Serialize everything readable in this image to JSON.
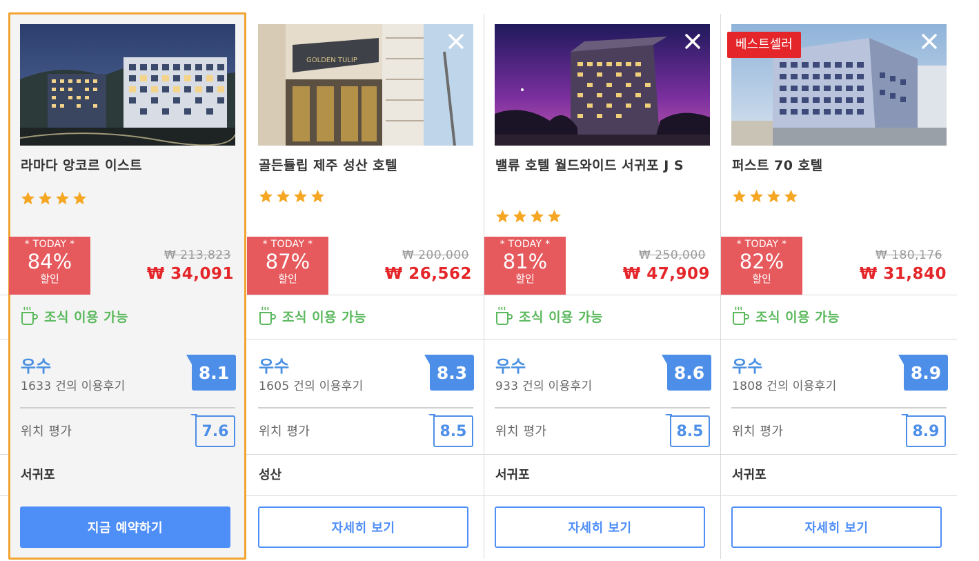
{
  "hotels": [
    {
      "name": "라마다 앙코르 이스트",
      "stars": 4,
      "discount_today": "* TODAY *",
      "discount_pct": "84%",
      "discount_sub": "할인",
      "original_price": "₩ 213,823",
      "sale_price": "₩ 34,091",
      "breakfast": "조식 이용 가능",
      "rating_word": "우수",
      "review_count": "1633 건의 이용후기",
      "score": "8.1",
      "location_label": "위치 평가",
      "location_score": "7.6",
      "area": "서귀포",
      "button_label": "지금 예약하기",
      "close_icon": "",
      "badge": ""
    },
    {
      "name": "골든튤립 제주 성산 호텔",
      "stars": 4,
      "discount_today": "* TODAY *",
      "discount_pct": "87%",
      "discount_sub": "할인",
      "original_price": "₩ 200,000",
      "sale_price": "₩ 26,562",
      "breakfast": "조식 이용 가능",
      "rating_word": "우수",
      "review_count": "1605 건의 이용후기",
      "score": "8.3",
      "location_label": "위치 평가",
      "location_score": "8.5",
      "area": "성산",
      "button_label": "자세히 보기",
      "badge": ""
    },
    {
      "name": "밸류 호텔 월드와이드 서귀포 J S",
      "stars": 4,
      "discount_today": "* TODAY *",
      "discount_pct": "81%",
      "discount_sub": "할인",
      "original_price": "₩ 250,000",
      "sale_price": "₩ 47,909",
      "breakfast": "조식 이용 가능",
      "rating_word": "우수",
      "review_count": "933 건의 이용후기",
      "score": "8.6",
      "location_label": "위치 평가",
      "location_score": "8.5",
      "area": "서귀포",
      "button_label": "자세히 보기",
      "badge": ""
    },
    {
      "name": "퍼스트 70 호텔",
      "stars": 4,
      "discount_today": "* TODAY *",
      "discount_pct": "82%",
      "discount_sub": "할인",
      "original_price": "₩ 180,176",
      "sale_price": "₩ 31,840",
      "breakfast": "조식 이용 가능",
      "rating_word": "우수",
      "review_count": "1808 건의 이용후기",
      "score": "8.9",
      "location_label": "위치 평가",
      "location_score": "8.9",
      "area": "서귀포",
      "button_label": "자세히 보기",
      "badge": "베스트셀러"
    }
  ],
  "colors": {
    "selected_border": "#f2a430",
    "discount_bg": "#e65a5e",
    "sale_price": "#e4262a",
    "breakfast_green": "#5ab85c",
    "score_blue": "#4d8fe8",
    "button_blue": "#4e8ef7",
    "star_orange": "#f5a623"
  },
  "icons": {
    "close": "close-icon",
    "star": "star-icon",
    "breakfast": "coffee-cup-icon"
  }
}
